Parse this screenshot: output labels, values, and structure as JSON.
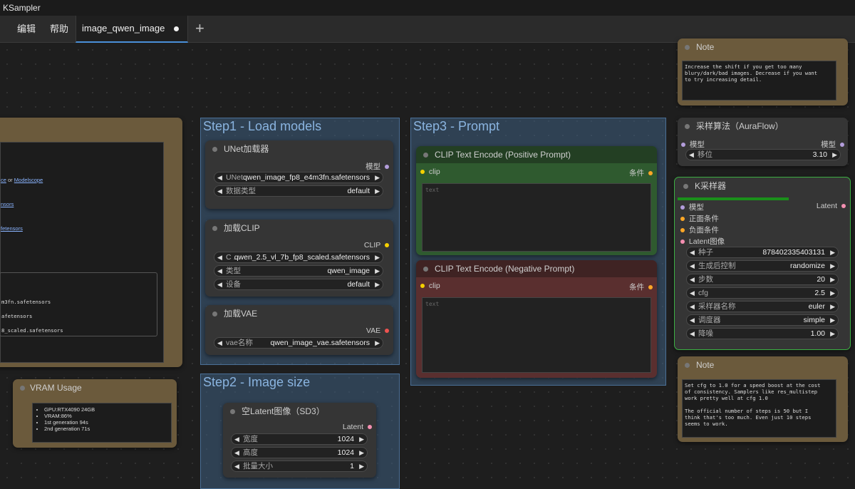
{
  "window": {
    "title": "KSampler"
  },
  "menu": {
    "items": [
      "编辑",
      "帮助"
    ]
  },
  "tabs": [
    {
      "label": "image_qwen_image"
    }
  ],
  "colors": {
    "group_blue": "#3e5f80",
    "note_brown": "#6b5a3c",
    "positive_green": "#2f5a2f",
    "negative_red": "#5a2f2f",
    "selected_green": "#3cb043"
  },
  "left_panel": {
    "links": [
      "ce",
      "or",
      "Modelscope",
      "nsors",
      "fetensors"
    ],
    "file_lines": [
      "m3fn.safetensors",
      "afetensors",
      "8_scaled.safetensors"
    ]
  },
  "vram": {
    "title": "VRAM Usage",
    "items": [
      "GPU:RTX4090 24GB",
      "VRAM:86%",
      "1st generation 94s",
      "2nd generation 71s"
    ]
  },
  "step1": {
    "title": "Step1 - Load models",
    "unet": {
      "title": "UNet加载器",
      "output": "模型",
      "name_label": "UNet...",
      "name_value": "qwen_image_fp8_e4m3fn.safetensors",
      "dtype_label": "数据类型",
      "dtype_value": "default"
    },
    "clip": {
      "title": "加载CLIP",
      "output": "CLIP",
      "name_label": "C ...",
      "name_value": "qwen_2.5_vl_7b_fp8_scaled.safetensors",
      "type_label": "类型",
      "type_value": "qwen_image",
      "device_label": "设备",
      "device_value": "default"
    },
    "vae": {
      "title": "加载VAE",
      "output": "VAE",
      "name_label": "vae名称",
      "name_value": "qwen_image_vae.safetensors"
    }
  },
  "step2": {
    "title": "Step2 - Image size",
    "latent": {
      "title": "空Latent图像（SD3）",
      "output": "Latent",
      "width_label": "宽度",
      "width_value": "1024",
      "height_label": "高度",
      "height_value": "1024",
      "batch_label": "批量大小",
      "batch_value": "1"
    }
  },
  "step3": {
    "title": "Step3 - Prompt",
    "positive": {
      "title": "CLIP Text Encode (Positive Prompt)",
      "input": "clip",
      "output": "条件",
      "placeholder": "text"
    },
    "negative": {
      "title": "CLIP Text Encode (Negative Prompt)",
      "input": "clip",
      "output": "条件",
      "placeholder": "text"
    }
  },
  "note_top": {
    "title": "Note",
    "text": "Increase the shift if you get too many\nblury/dark/bad images. Decrease if you want\nto try increasing detail."
  },
  "auraflow": {
    "title": "采样算法（AuraFlow）",
    "input": "模型",
    "output": "模型",
    "shift_label": "移位",
    "shift_value": "3.10"
  },
  "ksampler": {
    "title": "K采样器",
    "progress": 0.6,
    "inputs": [
      "模型",
      "正面条件",
      "负面条件",
      "Latent图像"
    ],
    "output": "Latent",
    "widgets": [
      {
        "label": "种子",
        "value": "878402335403131"
      },
      {
        "label": "生成后控制",
        "value": "randomize"
      },
      {
        "label": "步数",
        "value": "20"
      },
      {
        "label": "cfg",
        "value": "2.5"
      },
      {
        "label": "采样器名称",
        "value": "euler"
      },
      {
        "label": "调度器",
        "value": "simple"
      },
      {
        "label": "降噪",
        "value": "1.00"
      }
    ]
  },
  "note_bottom": {
    "title": "Note",
    "text": "Set cfg to 1.0 for a speed boost at the cost\nof consistency. Samplers like res_multistep\nwork pretty well at cfg 1.0\n\nThe official number of steps is 50 but I\nthink that's too much. Even just 10 steps\nseems to work."
  }
}
